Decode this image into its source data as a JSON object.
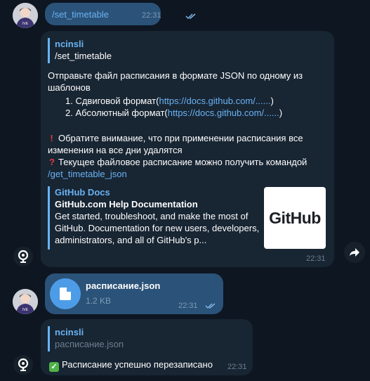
{
  "colors": {
    "background": "#0e1621",
    "outgoing_bubble": "#2b5278",
    "incoming_bubble": "#182533",
    "link": "#6ab3f3",
    "file_icon": "#4d9ce8"
  },
  "message1": {
    "text": "/set_timetable",
    "time": "22:31",
    "status_icon": "double-check-icon"
  },
  "message2": {
    "reply": {
      "author": "ncinsli",
      "text": "/set_timetable"
    },
    "line1": "Отправьте файл расписания в формате JSON по одному из шаблонов",
    "item1_prefix": "1. Сдвиговой формат(",
    "item1_link": "https://docs.github.com/......",
    "item1_suffix": ")",
    "item2_prefix": "2. Абсолютный формат(",
    "item2_link": "https://docs.github.com/......",
    "item2_suffix": ")",
    "warning_emoji": "!",
    "warning_text": "Обратите внимание, что при применении расписания все изменения на все дни удалятся",
    "question_emoji": "?",
    "current_text": "Текущее файловое расписание можно получить командой",
    "command_link": "/get_timetable_json",
    "preview": {
      "site": "GitHub Docs",
      "title": "GitHub.com Help Documentation",
      "description": "Get started, troubleshoot, and make the most of GitHub. Documentation for new users, developers, administrators, and all of GitHub's p...",
      "thumbnail_text": "GitHub"
    },
    "time": "22:31"
  },
  "message3": {
    "file_name": "расписание.json",
    "file_size": "1.2 KB",
    "time": "22:31",
    "status_icon": "double-check-icon"
  },
  "message4": {
    "reply": {
      "author": "ncinsli",
      "text": "расписание.json"
    },
    "emoji": "✓",
    "text": "Расписание успешно перезаписано",
    "time": "22:31"
  }
}
